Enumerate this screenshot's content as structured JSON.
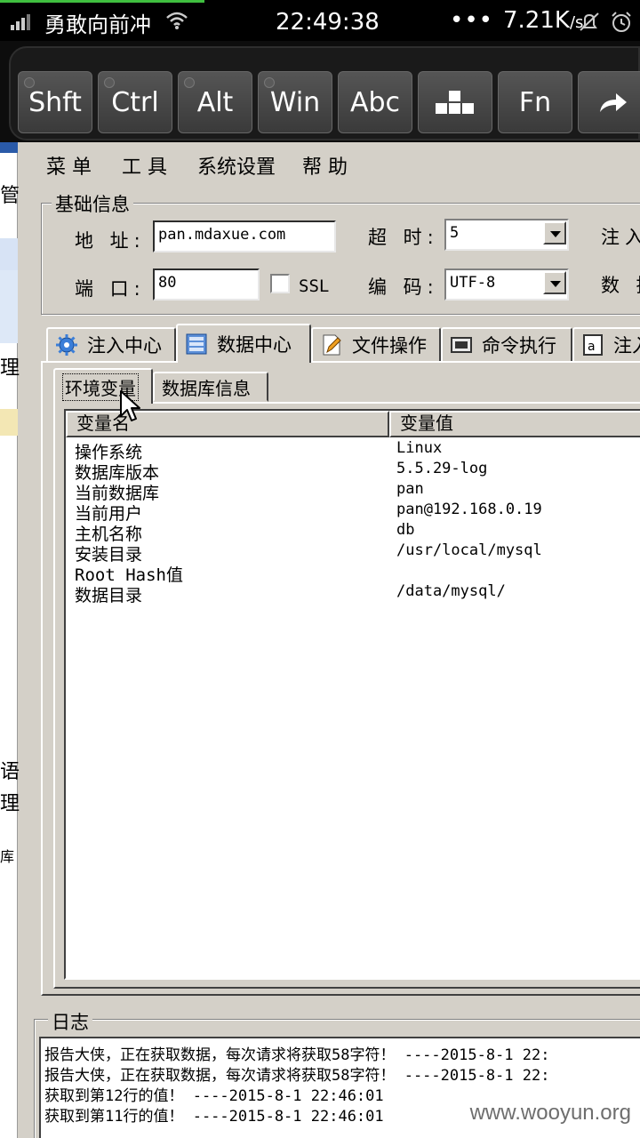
{
  "status_bar": {
    "carrier": "勇敢向前冲",
    "time": "22:49:38",
    "dots": "•••",
    "speed": "7.21K",
    "speed_unit": "/s"
  },
  "keyboard_bar": {
    "keys": [
      "Shft",
      "Ctrl",
      "Alt",
      "Win",
      "Abc",
      "",
      "Fn",
      ""
    ]
  },
  "menu": {
    "items": [
      "菜 单",
      "工 具",
      "系统设置",
      "帮 助"
    ]
  },
  "basic_info": {
    "title": "基础信息",
    "address_label": "地 址:",
    "address_value": "pan.mdaxue.com",
    "timeout_label": "超 时:",
    "timeout_value": "5",
    "inject_label": "注入",
    "port_label": "端 口:",
    "port_value": "80",
    "ssl_label": "SSL",
    "encoding_label": "编 码:",
    "encoding_value": "UTF-8",
    "data_label": "数 挑"
  },
  "tabs": {
    "main": [
      "注入中心",
      "数据中心",
      "文件操作",
      "命令执行",
      "注入"
    ],
    "sub": [
      "环境变量",
      "数据库信息"
    ]
  },
  "env_table": {
    "headers": [
      "变量名",
      "变量值"
    ],
    "rows": [
      {
        "name": "操作系统",
        "value": "Linux"
      },
      {
        "name": "数据库版本",
        "value": "5.5.29-log"
      },
      {
        "name": "当前数据库",
        "value": "pan"
      },
      {
        "name": "当前用户",
        "value": "pan@192.168.0.19"
      },
      {
        "name": "主机名称",
        "value": "db"
      },
      {
        "name": "安装目录",
        "value": "/usr/local/mysql"
      },
      {
        "name": "Root Hash值",
        "value": ""
      },
      {
        "name": "数据目录",
        "value": "/data/mysql/"
      }
    ]
  },
  "log": {
    "title": "日志",
    "lines": [
      "报告大侠，正在获取数据，每次请求将获取58字符！ ----2015-8-1 22:",
      "报告大侠，正在获取数据，每次请求将获取58字符！ ----2015-8-1 22:",
      "获取到第12行的值！ ----2015-8-1 22:46:01",
      "获取到第11行的值！ ----2015-8-1 22:46:01"
    ]
  },
  "left_strip": {
    "chars": [
      "管",
      "理",
      "语",
      "理",
      "库"
    ]
  },
  "watermark": "www.wooyun.org"
}
